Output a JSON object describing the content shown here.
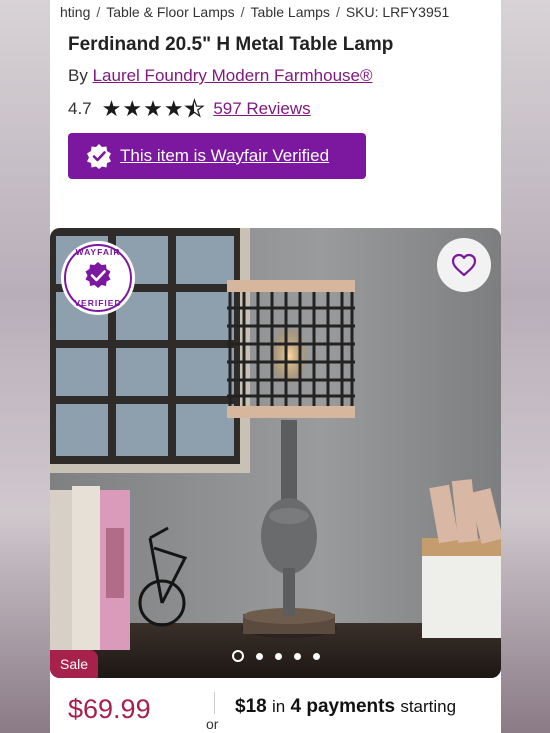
{
  "breadcrumb": {
    "items": [
      "hting",
      "Table & Floor Lamps",
      "Table Lamps",
      "SKU: LRFY3951"
    ],
    "separator": "/"
  },
  "product": {
    "title": "Ferdinand 20.5\" H Metal Table Lamp",
    "by_prefix": "By",
    "brand": "Laurel Foundry Modern Farmhouse®",
    "rating_value": "4.7",
    "rating_stars": 4.5,
    "reviews_label": "597 Reviews",
    "verified_label": "This item is Wayfair Verified"
  },
  "gallery": {
    "badge_text": "WAYFAIR VERIFIED",
    "sale_label": "Sale",
    "image_count": 5,
    "active_index": 0,
    "favorite_icon": "heart-icon"
  },
  "pricing": {
    "price": "$69.99",
    "or_label": "or",
    "installment_amount": "$18",
    "installment_in": "in",
    "installment_count_label": "4 payments",
    "installment_suffix": "starting"
  },
  "colors": {
    "accent_purple": "#7b189f",
    "link_purple": "#7f187f",
    "sale_red": "#a7214d"
  }
}
